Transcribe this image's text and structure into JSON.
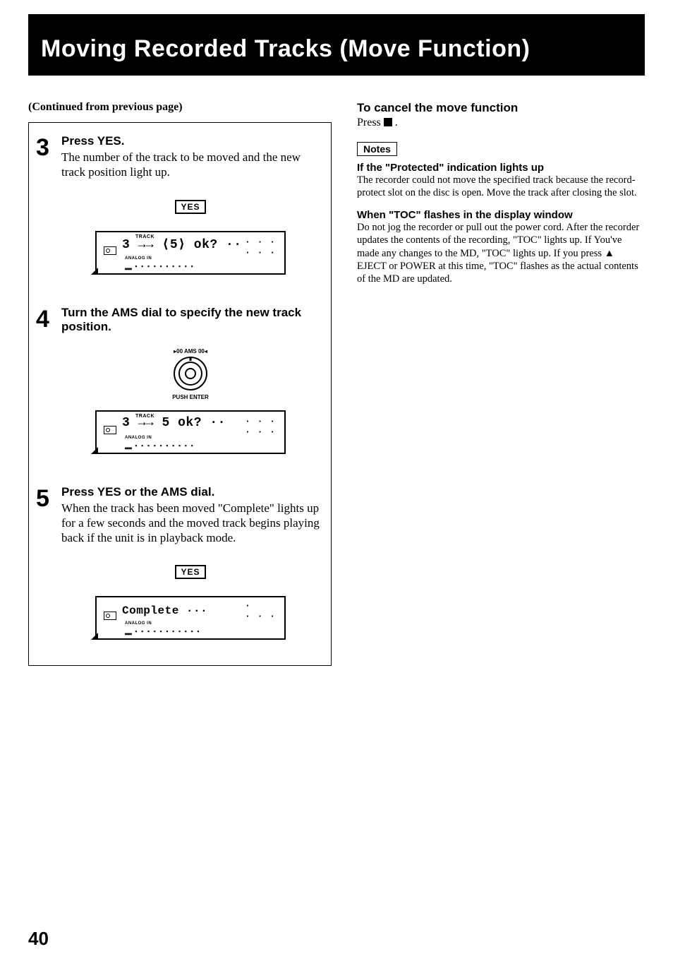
{
  "title": "Moving Recorded Tracks (Move Function)",
  "continued": "(Continued from previous page)",
  "steps": [
    {
      "num": "3",
      "head": "Press YES.",
      "body": "The number of the track to be moved and the new track position light up.",
      "button_label": "YES",
      "display": {
        "track_label": "TRACK",
        "line": "3  →→ ⟨5⟩  ok? ··",
        "analog": "ANALOG IN",
        "bars": "▂▂ ▪ ▪ ▪ ▪ ▪ ▪ ▪ ▪ ▪ ▪"
      }
    },
    {
      "num": "4",
      "head": "Turn the AMS dial to specify the new track position.",
      "body": "",
      "dial_top": "▸00 AMS 00◂",
      "dial_bottom": "PUSH ENTER",
      "display": {
        "track_label": "TRACK",
        "line": "3  →→  5   ok? ··",
        "analog": "ANALOG IN",
        "bars": "▂▂ ▪ ▪ ▪ ▪ ▪ ▪ ▪ ▪ ▪ ▪"
      }
    },
    {
      "num": "5",
      "head": "Press YES or the AMS dial.",
      "body": "When the track has been moved \"Complete\" lights up for a few seconds and the moved track begins playing back if the unit is in playback mode.",
      "button_label": "YES",
      "display": {
        "track_label": "",
        "line": "Complete      ···",
        "analog": "ANALOG IN",
        "bars": "▂▂ ▪ ▪ ▪ ▪ ▪ ▪ ▪ ▪ ▪ ▪ ▪"
      }
    }
  ],
  "cancel": {
    "head": "To cancel the move function",
    "body_prefix": "Press ",
    "body_suffix": " ."
  },
  "notes_label": "Notes",
  "notes": [
    {
      "head": "If the \"Protected\" indication lights up",
      "body": "The recorder could not move the specified track because the record-protect slot on the disc is open. Move the track after closing the slot."
    },
    {
      "head": "When \"TOC\" flashes in the display window",
      "body": "Do not jog the recorder or pull out the power cord. After the recorder updates the contents of the recording, \"TOC\" lights up. If You've made any changes to the MD, \"TOC\" lights up. If you press ▲ EJECT or POWER at this time, \"TOC\" flashes as the actual contents of the MD are updated."
    }
  ],
  "page_number": "40"
}
